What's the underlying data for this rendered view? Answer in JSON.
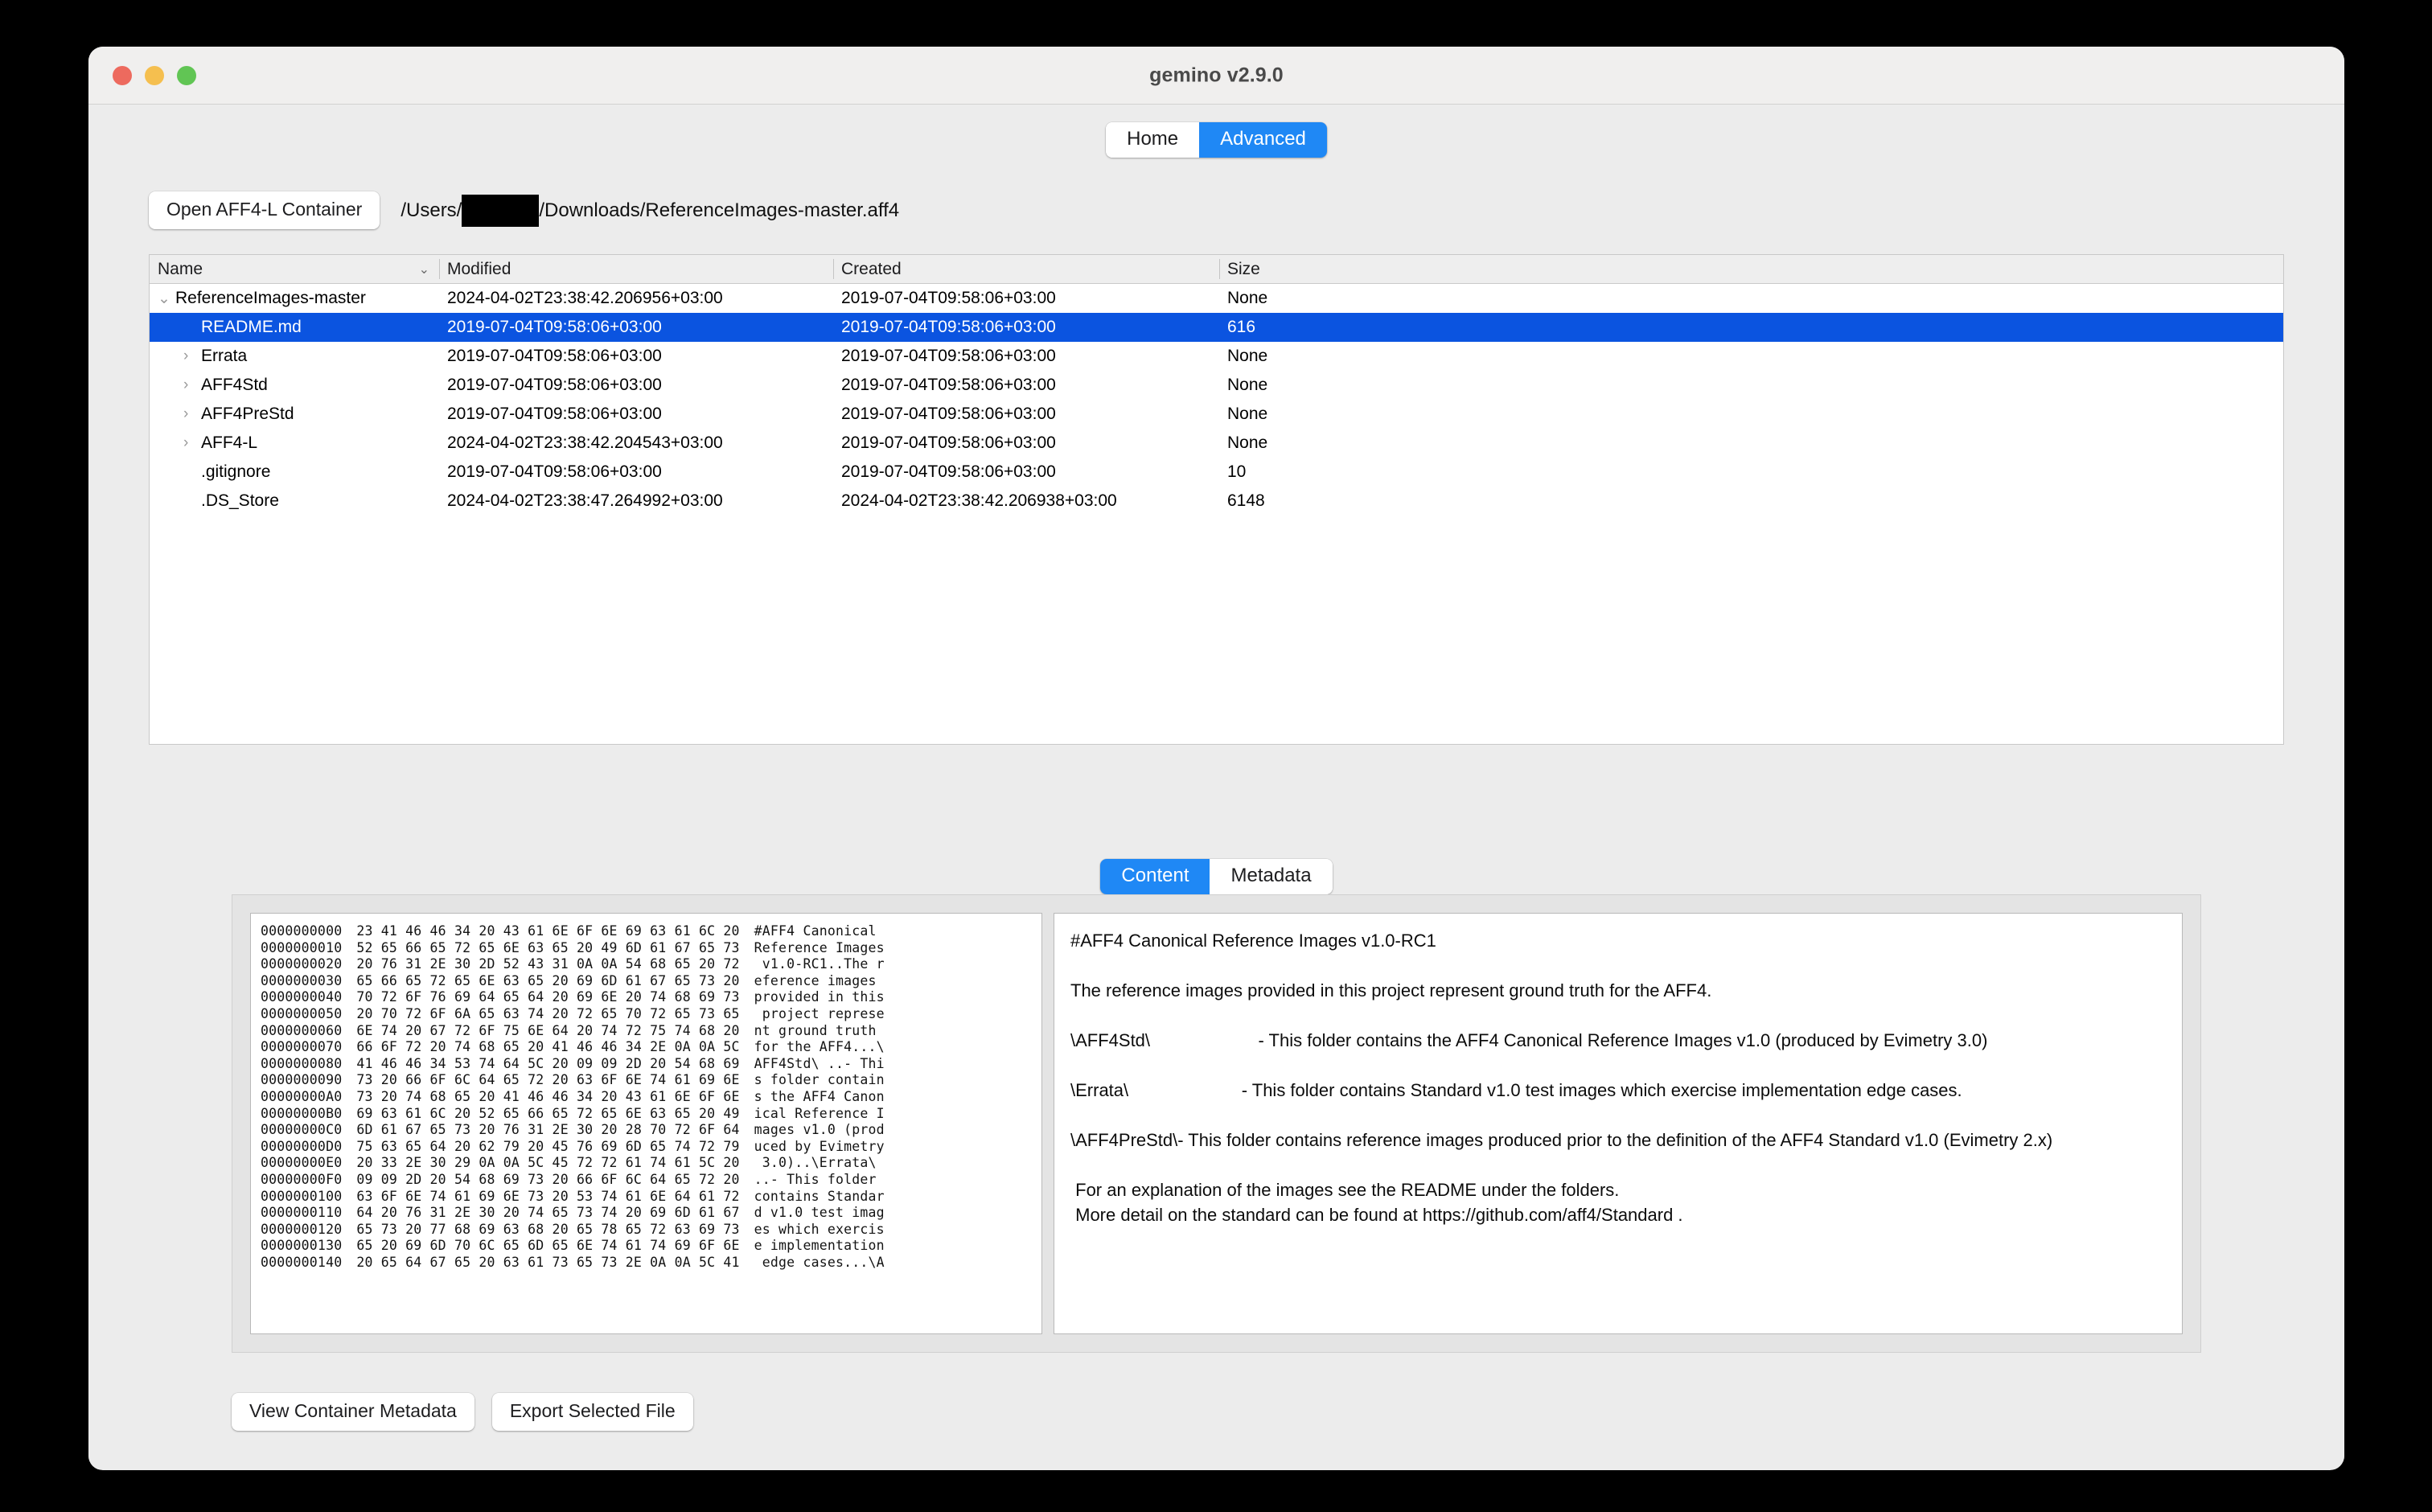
{
  "window": {
    "title": "gemino v2.9.0",
    "traffic_lights": [
      "close",
      "minimize",
      "maximize"
    ]
  },
  "top_tabs": {
    "items": [
      {
        "label": "Home",
        "active": false
      },
      {
        "label": "Advanced",
        "active": true
      }
    ]
  },
  "toolbar": {
    "open_button_label": "Open AFF4-L Container",
    "path_prefix": "/Users/",
    "path_redacted": true,
    "path_suffix": "/Downloads/ReferenceImages-master.aff4"
  },
  "file_table": {
    "columns": [
      {
        "key": "name",
        "label": "Name",
        "sort_indicator": "⌄"
      },
      {
        "key": "modified",
        "label": "Modified"
      },
      {
        "key": "created",
        "label": "Created"
      },
      {
        "key": "size",
        "label": "Size"
      }
    ],
    "rows": [
      {
        "name": "ReferenceImages-master",
        "modified": "2024-04-02T23:38:42.206956+03:00",
        "created": "2019-07-04T09:58:06+03:00",
        "size": "None",
        "indent": 0,
        "twisty": "expanded",
        "selected": false
      },
      {
        "name": "README.md",
        "modified": "2019-07-04T09:58:06+03:00",
        "created": "2019-07-04T09:58:06+03:00",
        "size": "616",
        "indent": 1,
        "twisty": "none",
        "selected": true
      },
      {
        "name": "Errata",
        "modified": "2019-07-04T09:58:06+03:00",
        "created": "2019-07-04T09:58:06+03:00",
        "size": "None",
        "indent": 1,
        "twisty": "collapsed",
        "selected": false
      },
      {
        "name": "AFF4Std",
        "modified": "2019-07-04T09:58:06+03:00",
        "created": "2019-07-04T09:58:06+03:00",
        "size": "None",
        "indent": 1,
        "twisty": "collapsed",
        "selected": false
      },
      {
        "name": "AFF4PreStd",
        "modified": "2019-07-04T09:58:06+03:00",
        "created": "2019-07-04T09:58:06+03:00",
        "size": "None",
        "indent": 1,
        "twisty": "collapsed",
        "selected": false
      },
      {
        "name": "AFF4-L",
        "modified": "2024-04-02T23:38:42.204543+03:00",
        "created": "2019-07-04T09:58:06+03:00",
        "size": "None",
        "indent": 1,
        "twisty": "collapsed",
        "selected": false
      },
      {
        "name": ".gitignore",
        "modified": "2019-07-04T09:58:06+03:00",
        "created": "2019-07-04T09:58:06+03:00",
        "size": "10",
        "indent": 1,
        "twisty": "none",
        "selected": false
      },
      {
        "name": ".DS_Store",
        "modified": "2024-04-02T23:38:47.264992+03:00",
        "created": "2024-04-02T23:38:42.206938+03:00",
        "size": "6148",
        "indent": 1,
        "twisty": "none",
        "selected": false
      }
    ]
  },
  "viewer_tabs": {
    "items": [
      {
        "label": "Content",
        "active": true
      },
      {
        "label": "Metadata",
        "active": false
      }
    ]
  },
  "hex_view": {
    "lines": [
      {
        "offset": "0000000000",
        "bytes": "23 41 46 46 34 20 43 61 6E 6F 6E 69 63 61 6C 20",
        "ascii": "#AFF4 Canonical"
      },
      {
        "offset": "0000000010",
        "bytes": "52 65 66 65 72 65 6E 63 65 20 49 6D 61 67 65 73",
        "ascii": "Reference Images"
      },
      {
        "offset": "0000000020",
        "bytes": "20 76 31 2E 30 2D 52 43 31 0A 0A 54 68 65 20 72",
        "ascii": " v1.0-RC1..The r"
      },
      {
        "offset": "0000000030",
        "bytes": "65 66 65 72 65 6E 63 65 20 69 6D 61 67 65 73 20",
        "ascii": "eference images "
      },
      {
        "offset": "0000000040",
        "bytes": "70 72 6F 76 69 64 65 64 20 69 6E 20 74 68 69 73",
        "ascii": "provided in this"
      },
      {
        "offset": "0000000050",
        "bytes": "20 70 72 6F 6A 65 63 74 20 72 65 70 72 65 73 65",
        "ascii": " project represe"
      },
      {
        "offset": "0000000060",
        "bytes": "6E 74 20 67 72 6F 75 6E 64 20 74 72 75 74 68 20",
        "ascii": "nt ground truth "
      },
      {
        "offset": "0000000070",
        "bytes": "66 6F 72 20 74 68 65 20 41 46 46 34 2E 0A 0A 5C",
        "ascii": "for the AFF4...\\"
      },
      {
        "offset": "0000000080",
        "bytes": "41 46 46 34 53 74 64 5C 20 09 09 2D 20 54 68 69",
        "ascii": "AFF4Std\\ ..- Thi"
      },
      {
        "offset": "0000000090",
        "bytes": "73 20 66 6F 6C 64 65 72 20 63 6F 6E 74 61 69 6E",
        "ascii": "s folder contain"
      },
      {
        "offset": "00000000A0",
        "bytes": "73 20 74 68 65 20 41 46 46 34 20 43 61 6E 6F 6E",
        "ascii": "s the AFF4 Canon"
      },
      {
        "offset": "00000000B0",
        "bytes": "69 63 61 6C 20 52 65 66 65 72 65 6E 63 65 20 49",
        "ascii": "ical Reference I"
      },
      {
        "offset": "00000000C0",
        "bytes": "6D 61 67 65 73 20 76 31 2E 30 20 28 70 72 6F 64",
        "ascii": "mages v1.0 (prod"
      },
      {
        "offset": "00000000D0",
        "bytes": "75 63 65 64 20 62 79 20 45 76 69 6D 65 74 72 79",
        "ascii": "uced by Evimetry"
      },
      {
        "offset": "00000000E0",
        "bytes": "20 33 2E 30 29 0A 0A 5C 45 72 72 61 74 61 5C 20",
        "ascii": " 3.0)..\\Errata\\ "
      },
      {
        "offset": "00000000F0",
        "bytes": "09 09 2D 20 54 68 69 73 20 66 6F 6C 64 65 72 20",
        "ascii": "..- This folder "
      },
      {
        "offset": "0000000100",
        "bytes": "63 6F 6E 74 61 69 6E 73 20 53 74 61 6E 64 61 72",
        "ascii": "contains Standar"
      },
      {
        "offset": "0000000110",
        "bytes": "64 20 76 31 2E 30 20 74 65 73 74 20 69 6D 61 67",
        "ascii": "d v1.0 test imag"
      },
      {
        "offset": "0000000120",
        "bytes": "65 73 20 77 68 69 63 68 20 65 78 65 72 63 69 73",
        "ascii": "es which exercis"
      },
      {
        "offset": "0000000130",
        "bytes": "65 20 69 6D 70 6C 65 6D 65 6E 74 61 74 69 6F 6E",
        "ascii": "e implementation"
      },
      {
        "offset": "0000000140",
        "bytes": "20 65 64 67 65 20 63 61 73 65 73 2E 0A 0A 5C 41",
        "ascii": " edge cases...\\A"
      }
    ]
  },
  "text_view": {
    "paragraphs": [
      "#AFF4 Canonical Reference Images v1.0-RC1",
      "",
      "The reference images provided in this project represent ground truth for the AFF4.",
      "",
      "\\AFF4Std\\                      - This folder contains the AFF4 Canonical Reference Images v1.0 (produced by Evimetry 3.0)",
      "",
      "\\Errata\\                       - This folder contains Standard v1.0 test images which exercise implementation edge cases.",
      "",
      "\\AFF4PreStd\\- This folder contains reference images produced prior to the definition of the AFF4 Standard v1.0 (Evimetry 2.x)",
      "",
      " For an explanation of the images see the README under the folders.",
      " More detail on the standard can be found at https://github.com/aff4/Standard ."
    ]
  },
  "footer": {
    "view_metadata_label": "View Container Metadata",
    "export_label": "Export Selected File"
  },
  "colors": {
    "accent": "#1f88f5",
    "selection": "#0b54e0",
    "window_chrome": "#f0efee",
    "app_background": "#ececec"
  }
}
